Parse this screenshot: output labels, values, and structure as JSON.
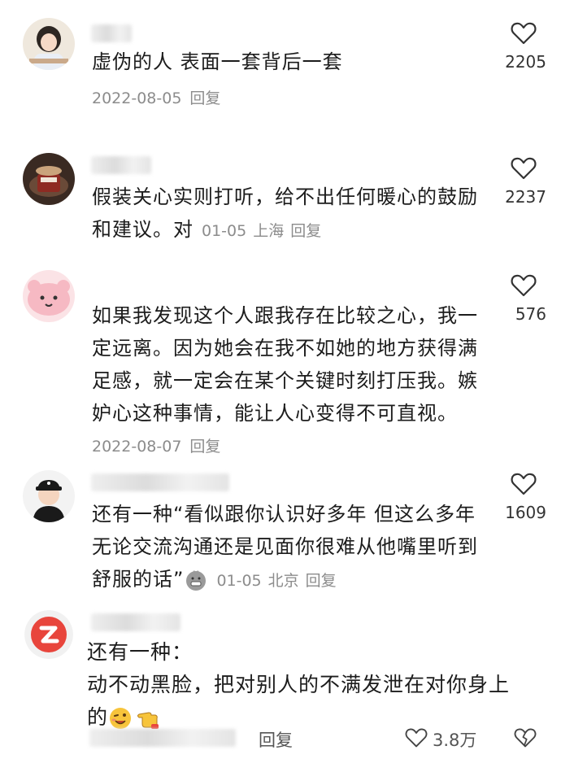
{
  "comments": [
    {
      "text": "虚伪的人 表面一套背后一套",
      "date": "2022-08-05",
      "reply": "回复",
      "likes": "2205"
    },
    {
      "text": "假装关心实则打听，给不出任何暖心的鼓励和建议。对",
      "date": "01-05",
      "location": "上海",
      "reply": "回复",
      "likes": "2237"
    },
    {
      "text_lines": [
        "如果我发现这个人跟我存在比较之心，我一",
        "定远离。因为她会在我不如她的地方获得满",
        "足感，就一定会在某个关键时刻打压我。嫉",
        "妒心这种事情，能让人心变得不可直视。"
      ],
      "date": "2022-08-07",
      "reply": "回复",
      "likes": "576"
    },
    {
      "text_lines": [
        "还有一种“看似跟你认识好多年 但这么多年",
        "无论交流沟通还是见面你很难从他嘴里听到",
        "舒服的话”"
      ],
      "emoji": "grimace-emoji",
      "date": "01-05",
      "location": "北京",
      "reply": "回复",
      "likes": "1609"
    },
    {
      "text_lines": [
        "还有一种：",
        "动不动黑脸，把对别人的不满发泄在对你身上",
        "的"
      ],
      "emojis": [
        "wink-emoji",
        "pointing-hand-emoji"
      ]
    }
  ],
  "bottom": {
    "reply": "回复",
    "likes": "3.8万"
  },
  "colors": {
    "text": "#1c1c1c",
    "meta": "#8c8c8c",
    "icon_stroke": "#333333",
    "brand_red": "#e8453c"
  }
}
